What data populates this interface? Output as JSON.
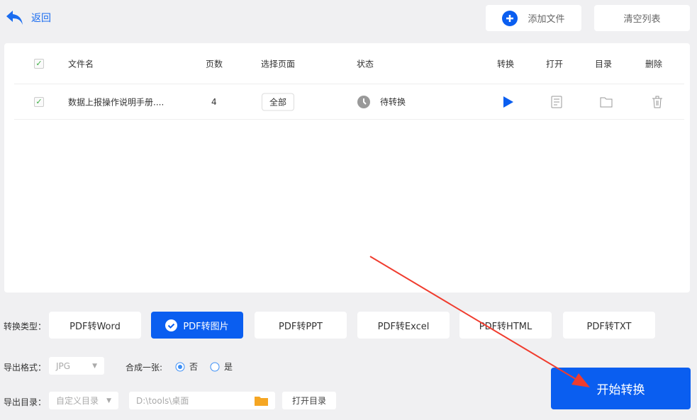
{
  "header": {
    "back_label": "返回",
    "add_file": "添加文件",
    "clear_list": "清空列表"
  },
  "table": {
    "columns": [
      "文件名",
      "页数",
      "选择页面",
      "状态",
      "转换",
      "打开",
      "目录",
      "删除"
    ],
    "rows": [
      {
        "name": "数据上报操作说明手册....",
        "pages": "4",
        "page_select": "全部",
        "status": "待转换"
      }
    ]
  },
  "options": {
    "type_label": "转换类型：",
    "types": [
      "PDF转Word",
      "PDF转图片",
      "PDF转PPT",
      "PDF转Excel",
      "PDF转HTML",
      "PDF转TXT"
    ],
    "selected_type": "PDF转图片",
    "format_label": "导出格式：",
    "format_value": "JPG",
    "merge_label": "合成一张:",
    "merge_no": "否",
    "merge_yes": "是",
    "merge_selected": "否",
    "dir_label": "导出目录：",
    "dir_mode": "自定义目录",
    "dir_path": "D:\\tools\\桌面",
    "open_dir": "打开目录"
  },
  "start_button": "开始转换",
  "colors": {
    "accent": "#0a5ef0",
    "annotation": "#f03c2e"
  }
}
